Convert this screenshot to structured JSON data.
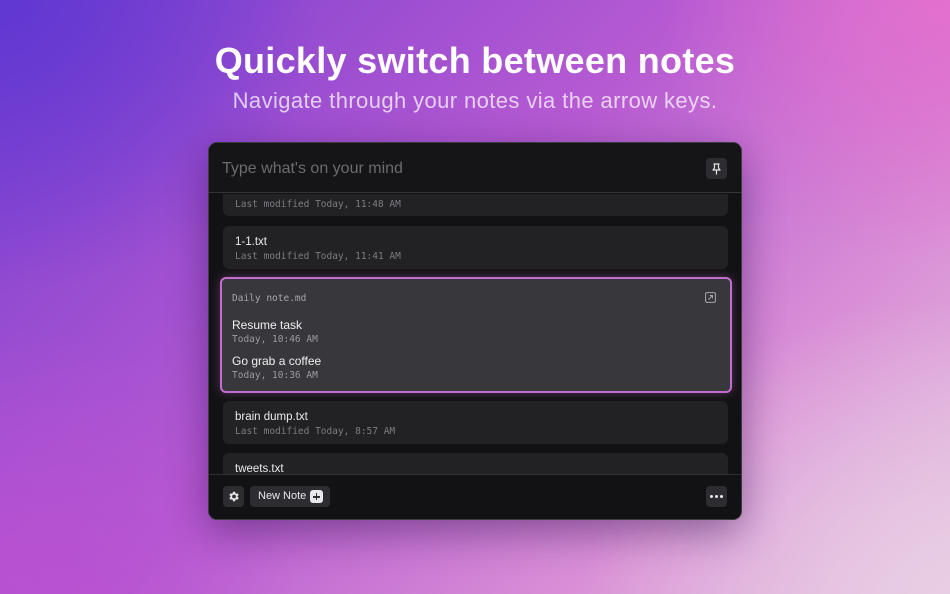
{
  "hero": {
    "title": "Quickly switch between notes",
    "subtitle": "Navigate through your notes via the arrow keys."
  },
  "input": {
    "placeholder": "Type what's on your mind"
  },
  "notes": {
    "partial_top_meta": "Last modified Today, 11:48 AM",
    "note_1_name": "1-1.txt",
    "note_1_meta": "Last modified Today, 11:41 AM",
    "selected": {
      "filename": "Daily note.md",
      "tasks": [
        {
          "title": "Resume task",
          "time": "Today, 10:46 AM"
        },
        {
          "title": "Go grab a coffee",
          "time": "Today, 10:36 AM"
        }
      ]
    },
    "note_3_name": "brain dump.txt",
    "note_3_meta": "Last modified Today, 8:57 AM",
    "note_4_name": "tweets.txt"
  },
  "footer": {
    "new_note_label": "New Note"
  },
  "icons": {
    "pin": "pin-icon",
    "settings": "gear-icon",
    "open": "open-external-icon",
    "add": "plus-icon",
    "more": "more-horizontal-icon"
  },
  "colors": {
    "selection_border": "#c36cd0",
    "window_bg": "#121214",
    "card_bg": "#222225"
  }
}
